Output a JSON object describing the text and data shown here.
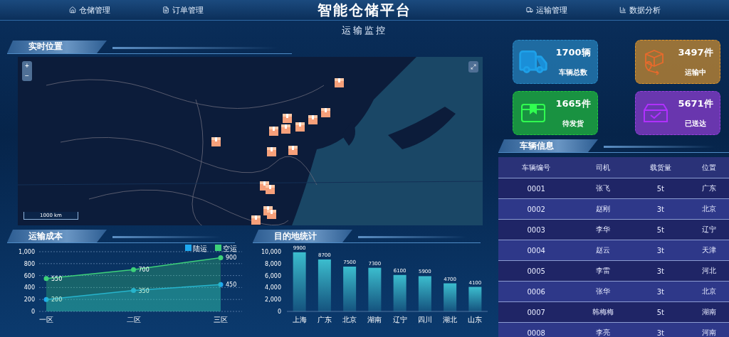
{
  "header": {
    "title": "智能仓储平台",
    "subtitle": "运输监控",
    "nav": [
      {
        "label": "仓储管理",
        "kind": "home"
      },
      {
        "label": "订单管理",
        "kind": "order"
      },
      {
        "label": "运输管理",
        "kind": "truck"
      },
      {
        "label": "数据分析",
        "kind": "chart"
      }
    ]
  },
  "map": {
    "title": "实时位置",
    "zoom_in": "+",
    "zoom_out": "−",
    "scale": "1000 km"
  },
  "stats": [
    {
      "value": "1700辆",
      "label": "车辆总数",
      "kind": "truck",
      "color": "#2a8cc8"
    },
    {
      "value": "3497件",
      "label": "运输中",
      "kind": "route",
      "color": "#e0962c"
    },
    {
      "value": "1665件",
      "label": "待发货",
      "kind": "package",
      "color": "#22c93c"
    },
    {
      "value": "5671件",
      "label": "已送达",
      "kind": "delivered",
      "color": "#9b3fe0"
    }
  ],
  "vehicles": {
    "title": "车辆信息",
    "columns": [
      "车辆编号",
      "司机",
      "载货量",
      "位置"
    ],
    "rows": [
      [
        "0001",
        "张飞",
        "5t",
        "广东"
      ],
      [
        "0002",
        "赵刚",
        "3t",
        "北京"
      ],
      [
        "0003",
        "李华",
        "5t",
        "辽宁"
      ],
      [
        "0004",
        "赵云",
        "3t",
        "天津"
      ],
      [
        "0005",
        "李雷",
        "3t",
        "河北"
      ],
      [
        "0006",
        "张华",
        "3t",
        "北京"
      ],
      [
        "0007",
        "韩梅梅",
        "5t",
        "湖南"
      ],
      [
        "0008",
        "李亮",
        "3t",
        "河南"
      ]
    ]
  },
  "cost": {
    "title": "运输成本",
    "chart_data": {
      "type": "area",
      "grid": true,
      "legend": "top-right",
      "categories": [
        "一区",
        "二区",
        "三区"
      ],
      "ylim": [
        0,
        1000
      ],
      "yticks": [
        {
          "value": 0,
          "label": "0"
        },
        {
          "value": 200,
          "label": "200"
        },
        {
          "value": 400,
          "label": "400"
        },
        {
          "value": 600,
          "label": "600"
        },
        {
          "value": 800,
          "label": "800"
        },
        {
          "value": 1000,
          "label": "1,000"
        }
      ],
      "data_labels": true,
      "series": [
        {
          "name": "陆运",
          "color": "#1ea8f0",
          "values": [
            200,
            350,
            450
          ]
        },
        {
          "name": "空运",
          "color": "#3dd17a",
          "values": [
            550,
            700,
            900
          ]
        }
      ]
    }
  },
  "destinations": {
    "title": "目的地统计",
    "chart_data": {
      "type": "bar",
      "categories": [
        "上海",
        "广东",
        "北京",
        "湖南",
        "辽宁",
        "四川",
        "湖北",
        "山东"
      ],
      "ylim": [
        0,
        10000
      ],
      "yticks": [
        {
          "value": 0,
          "label": "0"
        },
        {
          "value": 2000,
          "label": "2,000"
        },
        {
          "value": 4000,
          "label": "4,000"
        },
        {
          "value": 6000,
          "label": "6,000"
        },
        {
          "value": 8000,
          "label": "8,000"
        },
        {
          "value": 10000,
          "label": "10,000"
        }
      ],
      "data_labels": true,
      "series": [
        {
          "color": "#3ec4d4",
          "values": [
            9900,
            8700,
            7500,
            7300,
            6100,
            5900,
            4700,
            4100
          ]
        }
      ]
    }
  }
}
